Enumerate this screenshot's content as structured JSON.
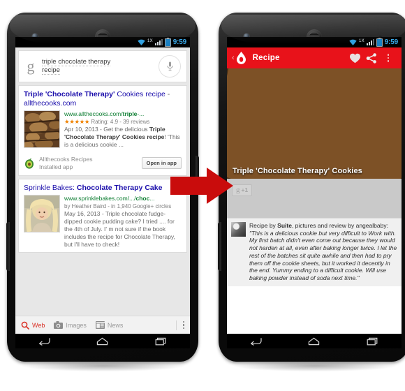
{
  "status_bar": {
    "carrier": "1X",
    "time": "9:59",
    "icons": [
      "wifi-icon",
      "signal-icon",
      "battery-icon"
    ]
  },
  "left_phone": {
    "app": "Google Search",
    "search": {
      "logo": "g",
      "query": "triple chocolate therapy recipe",
      "query_line1": "triple chocolate therapy",
      "query_line2": "recipe",
      "mic_icon": "microphone-icon"
    },
    "results": [
      {
        "title_bold": "Triple 'Chocolate Therapy'",
        "title_rest": " Cookies recipe",
        "title_dash": " - ",
        "title_domain": "allthecooks.com",
        "url": "www.allthecooks.com/",
        "url_bold": "triple",
        "url_tail": "-...",
        "stars": "★★★★★",
        "rating": "Rating: 4.9 - 39 reviews",
        "date": "Apr 10, 2013 - ",
        "snippet_a": "Get the delicious ",
        "snippet_b": "Triple 'Chocolate Therapy' Cookies recipe",
        "snippet_c": "! 'This is a delicious cookie ...",
        "thumb": "cookie-thumbnail"
      },
      {
        "title_plain": "Sprinkle Bakes: ",
        "title_bold": "Chocolate Therapy Cake",
        "url": "www.sprinklebakes.com/.../",
        "url_bold": "choc",
        "url_tail": "...",
        "author": "by Heather Baird - in 1,940 Google+ circles",
        "date": "May 16, 2013 - ",
        "snippet": "Triple chocolate fudge-dipped cookie pudding cake? I tried .... for the 4th of July. I' m not sure if the book includes the recipe for Chocolate Therapy, but I'll have to check!",
        "thumb": "author-photo-thumbnail"
      }
    ],
    "app_promo": {
      "icon": "allthecooks-avocado-icon",
      "name": "Allthecooks Recipes",
      "subtitle": "Installed app",
      "button": "Open in app"
    },
    "tabs": [
      {
        "label": "Web",
        "icon": "search-icon",
        "active": true
      },
      {
        "label": "Images",
        "icon": "camera-icon",
        "active": false
      },
      {
        "label": "News",
        "icon": "news-icon",
        "active": false
      }
    ],
    "overflow_icon": "kebab-menu-icon"
  },
  "right_phone": {
    "app": "Allthecooks Recipes",
    "toolbar": {
      "back_icon": "back-chevron-icon",
      "app_icon": "allthecooks-drop-icon",
      "title": "Recipe",
      "favorite_icon": "heart-icon",
      "share_icon": "share-icon",
      "overflow_icon": "kebab-menu-icon"
    },
    "hero": {
      "image": "chocolate-cookie-photo",
      "title": "Triple 'Chocolate Therapy' Cookies"
    },
    "social": {
      "plus_one_g": "g",
      "plus_one_label": "+1"
    },
    "review": {
      "avatar": "reviewer-avatar",
      "byline_a": "Recipe by ",
      "byline_bold": "Suite",
      "byline_b": ", pictures and review by angealbaby:",
      "quote": "\"This is a delicious cookie but very difficult to Work with. My first batch didn't even come out because they would not harden at all, even after baking longer twice. I let the rest of the batches sit quite awhile and then had to pry them off the cookie sheets, but it worked it decently in the end. Yummy ending to a difficult cookie. Will use baking powder instead of soda next time.\""
    }
  },
  "nav_bar": {
    "back_icon": "android-back-icon",
    "home_icon": "android-home-icon",
    "recents_icon": "android-recents-icon"
  },
  "annotation": {
    "arrow_icon": "red-right-arrow",
    "arrow_color": "#c90c0c"
  },
  "colors": {
    "brand_red": "#e8121a",
    "google_blue": "#1a0dab",
    "url_green": "#0a7c2f",
    "star_orange": "#ef8200",
    "status_blue": "#3aa8e8"
  }
}
